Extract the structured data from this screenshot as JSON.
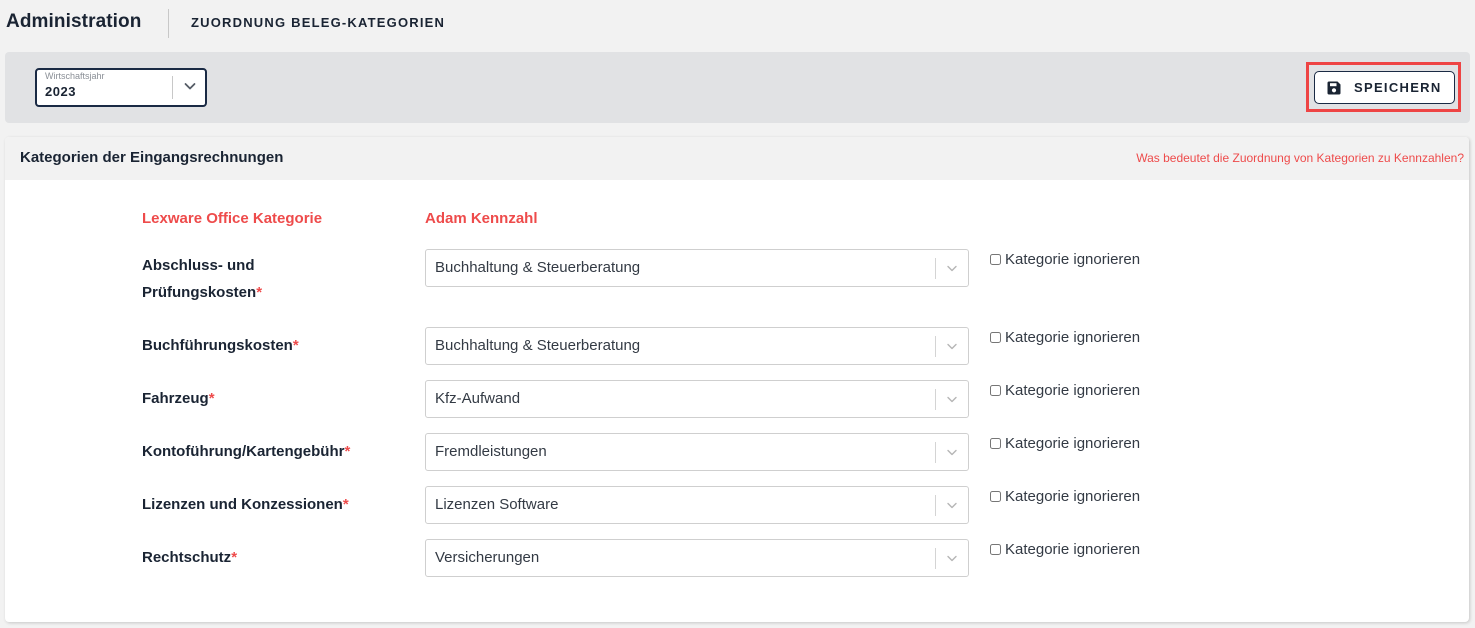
{
  "header": {
    "app_title": "Administration",
    "page_subtitle": "ZUORDNUNG BELEG-KATEGORIEN"
  },
  "toolbar": {
    "year_select": {
      "label": "Wirtschaftsjahr",
      "value": "2023"
    },
    "save_label": "SPEICHERN",
    "save_icon": "floppy-disk-icon",
    "highlight_color": "#ee4444"
  },
  "panel": {
    "title": "Kategorien der Eingangsrechnungen",
    "help_link": "Was bedeutet die Zuordnung von Kategorien zu Kennzahlen?",
    "columns": {
      "category": "Lexware Office Kategorie",
      "kennzahl": "Adam Kennzahl"
    },
    "required_marker": "*",
    "rows": [
      {
        "label_line1": "Abschluss- und",
        "label_line2": "Prüfungskosten",
        "value": "Buchhaltung & Steuerberatung",
        "ignore_label": "Kategorie ignorieren",
        "ignored": false
      },
      {
        "label_line1": "Buchführungskosten",
        "value": "Buchhaltung & Steuerberatung",
        "ignore_label": "Kategorie ignorieren",
        "ignored": false
      },
      {
        "label_line1": "Fahrzeug",
        "value": "Kfz-Aufwand",
        "ignore_label": "Kategorie ignorieren",
        "ignored": false
      },
      {
        "label_line1": "Kontoführung/Kartengebühr",
        "value": "Fremdleistungen",
        "ignore_label": "Kategorie ignorieren",
        "ignored": false
      },
      {
        "label_line1": "Lizenzen und Konzessionen",
        "value": "Lizenzen Software",
        "ignore_label": "Kategorie ignorieren",
        "ignored": false
      },
      {
        "label_line1": "Rechtschutz",
        "value": "Versicherungen",
        "ignore_label": "Kategorie ignorieren",
        "ignored": false
      }
    ]
  },
  "colors": {
    "accent_red": "#ee4b4b",
    "navy": "#1a2433"
  }
}
